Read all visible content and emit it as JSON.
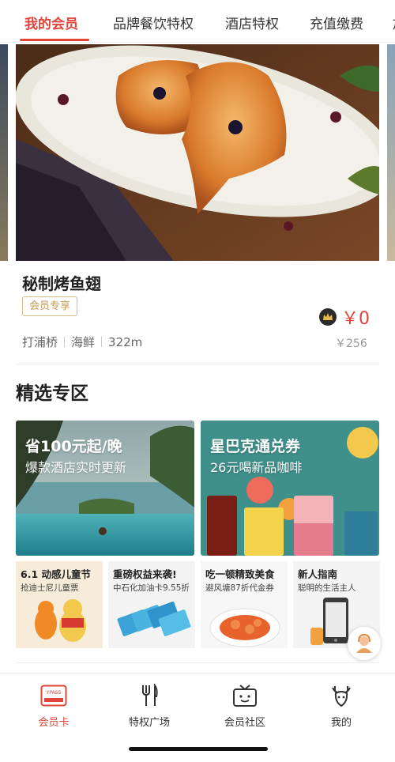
{
  "tabs": [
    {
      "label": "我的会员",
      "active": true
    },
    {
      "label": "品牌餐饮特权",
      "active": false
    },
    {
      "label": "酒店特权",
      "active": false
    },
    {
      "label": "充值缴费",
      "active": false
    },
    {
      "label": "加",
      "active": false
    }
  ],
  "featured": {
    "title": "秘制烤鱼翅",
    "tag": "会员专享",
    "price": "￥0",
    "original_price": "￥256",
    "area": "打浦桥",
    "category": "海鲜",
    "distance": "322m",
    "badge_icon": "crown-icon"
  },
  "section_title": "精选专区",
  "banners": [
    {
      "title": "省100元起/晚",
      "subtitle": "爆款酒店实时更新"
    },
    {
      "title": "星巴克通兑券",
      "subtitle": "26元喝新品咖啡"
    }
  ],
  "cards": [
    {
      "title": "6.1 动感儿童节",
      "subtitle": "抢迪士尼儿童票"
    },
    {
      "title": "重磅权益来袭!",
      "subtitle": "中石化加油卡9.55折"
    },
    {
      "title": "吃一顿精致美食",
      "subtitle": "避风塘87折代金券"
    },
    {
      "title": "新人指南",
      "subtitle": "聪明的生活主人"
    }
  ],
  "bottom_nav": [
    {
      "label": "会员卡",
      "icon": "ypass-card-icon",
      "active": true,
      "icon_text": "YPASS"
    },
    {
      "label": "特权广场",
      "icon": "fork-knife-icon",
      "active": false
    },
    {
      "label": "会员社区",
      "icon": "tv-face-icon",
      "active": false
    },
    {
      "label": "我的",
      "icon": "antler-face-icon",
      "active": false
    }
  ],
  "colors": {
    "accent": "#e0443a",
    "tag_gold": "#c79a57"
  }
}
